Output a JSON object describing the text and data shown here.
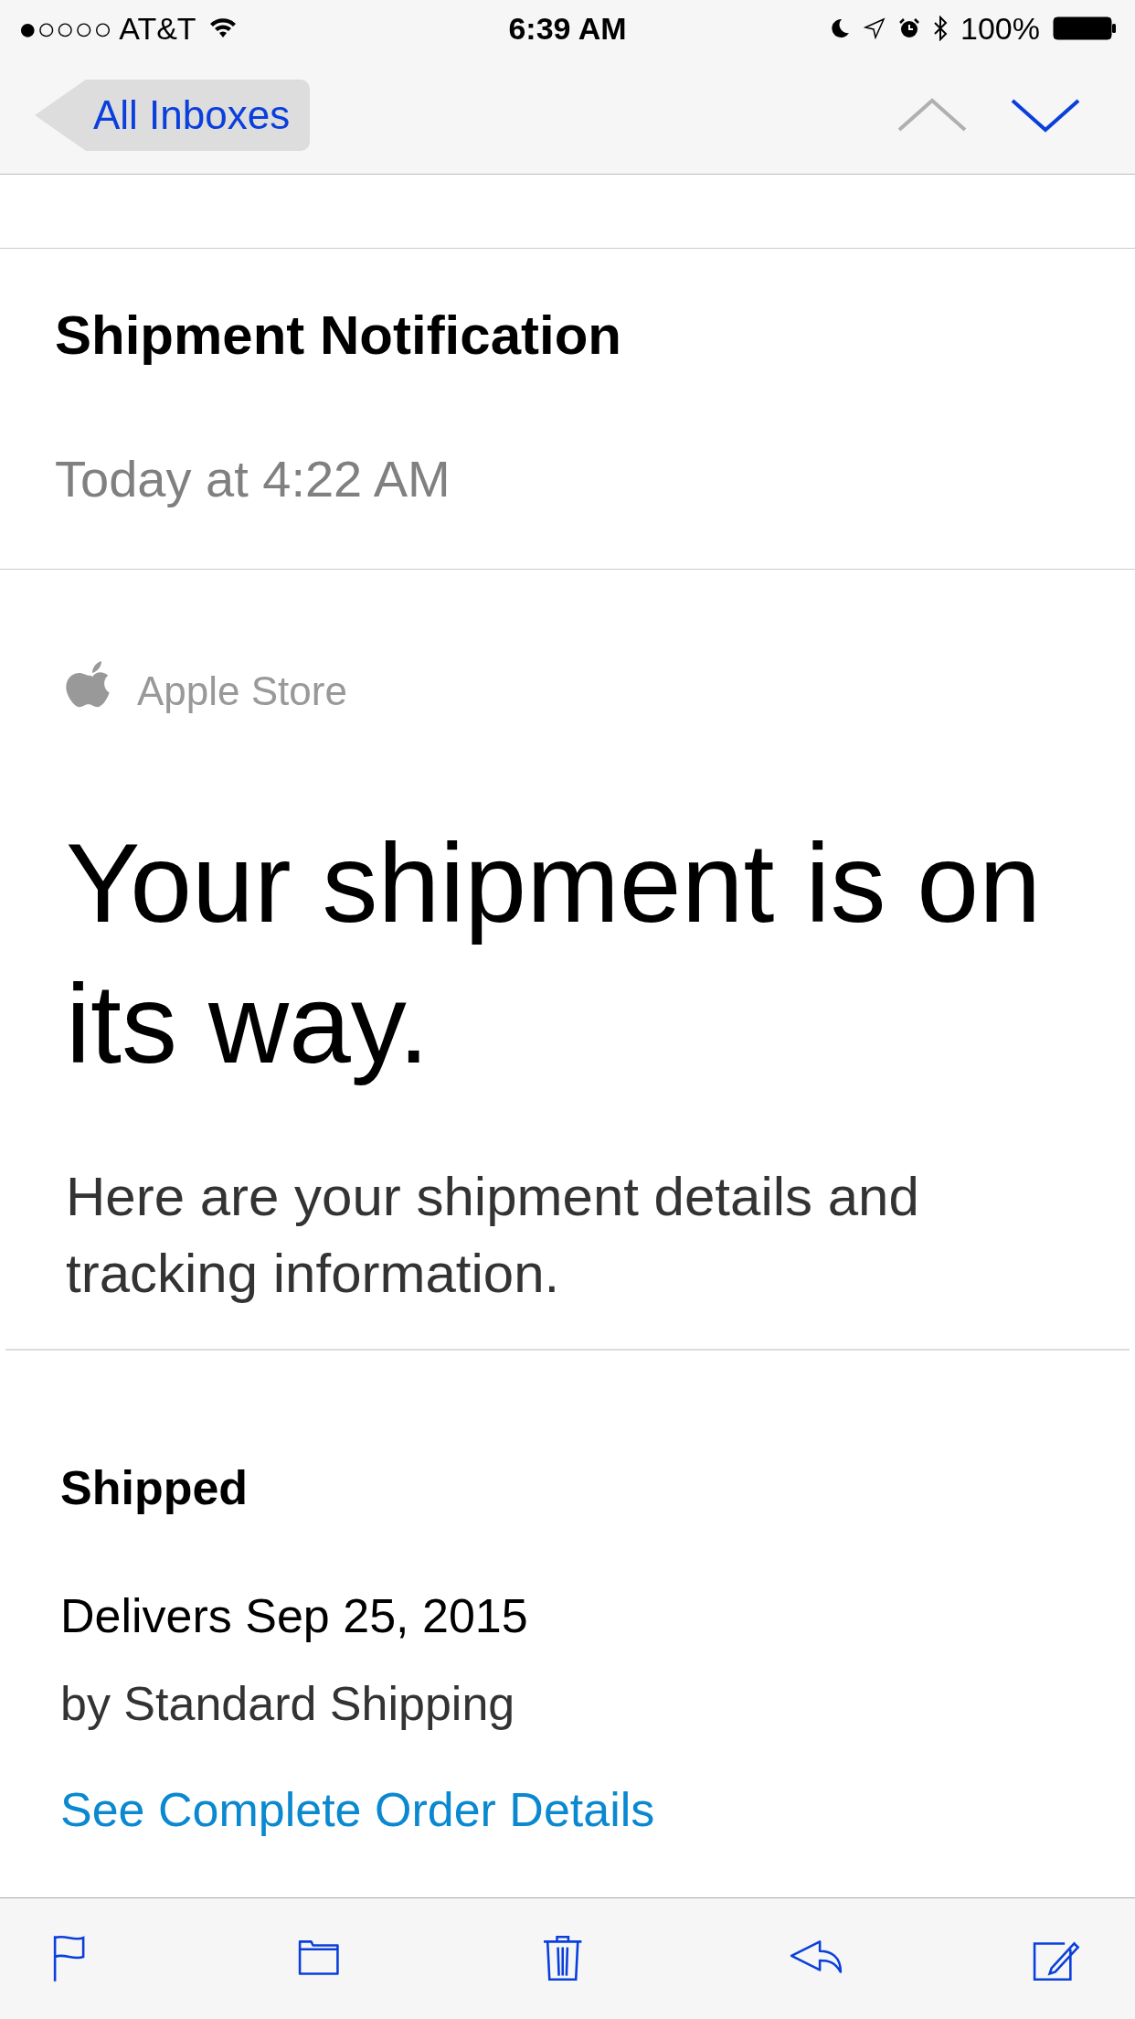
{
  "status_bar": {
    "carrier": "●○○○○ AT&T",
    "time": "6:39 AM",
    "battery": "100%"
  },
  "nav": {
    "back": "All Inboxes",
    "previous_disabled": true,
    "next_disabled": false
  },
  "header": {
    "subject": "Shipment Notification",
    "date": "Today at 4:22 AM"
  },
  "body": {
    "brand": "Apple Store",
    "headline": "Your shipment is on its way.",
    "intro": "Here are your shipment details and tracking information.",
    "status": "Shipped",
    "delivery": "Delivers Sep 25, 2015",
    "method": "by Standard Shipping",
    "link": "See Complete Order Details"
  },
  "toolbar": [
    {
      "kind": "flag"
    },
    {
      "kind": "folder"
    },
    {
      "kind": "trash"
    },
    {
      "kind": "reply"
    },
    {
      "kind": "compose"
    }
  ]
}
